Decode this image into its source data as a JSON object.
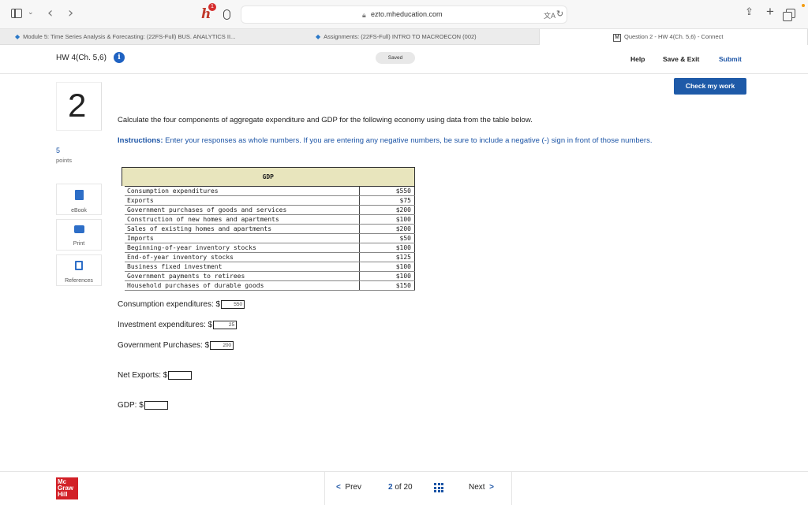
{
  "browser": {
    "url": "ezto.mheducation.com",
    "extension_badge": "1"
  },
  "tabs": [
    {
      "label": "Module 5: Time Series Analysis & Forecasting: (22FS-Full) BUS. ANALYTICS II..."
    },
    {
      "label": "Assignments: (22FS-Full) INTRO TO MACROECON (002)"
    },
    {
      "label": "Question 2 - HW 4(Ch. 5,6) - Connect"
    }
  ],
  "header": {
    "title": "HW 4(Ch. 5,6)",
    "saved": "Saved",
    "help": "Help",
    "save_exit": "Save & Exit",
    "submit": "Submit"
  },
  "check_my_work": "Check my work",
  "question": {
    "number": "2",
    "points_value": "5",
    "points_label": "points",
    "text": "Calculate the four components of aggregate expenditure and GDP for the following economy using data from the table below.",
    "instructions_label": "Instructions:",
    "instructions_text": " Enter your responses as whole numbers. If you are entering any negative numbers, be sure to include a negative (-) sign in front of those numbers."
  },
  "tools": {
    "ebook": "eBook",
    "print": "Print",
    "references": "References"
  },
  "table": {
    "header": "GDP",
    "rows": [
      {
        "label": "Consumption expenditures",
        "value": "$550"
      },
      {
        "label": "Exports",
        "value": "$75"
      },
      {
        "label": "Government purchases of goods and services",
        "value": "$200"
      },
      {
        "label": "Construction of new homes and apartments",
        "value": "$100"
      },
      {
        "label": "Sales of existing homes and apartments",
        "value": "$200"
      },
      {
        "label": "Imports",
        "value": "$50"
      },
      {
        "label": "Beginning-of-year inventory stocks",
        "value": "$100"
      },
      {
        "label": "End-of-year inventory stocks",
        "value": "$125"
      },
      {
        "label": "Business fixed investment",
        "value": "$100"
      },
      {
        "label": "Government payments to retirees",
        "value": "$100"
      },
      {
        "label": "Household purchases of durable goods",
        "value": "$150"
      }
    ]
  },
  "answers": {
    "consumption_label": "Consumption expenditures: $",
    "consumption_value": "550",
    "investment_label": "Investment expenditures: $",
    "investment_value": "25",
    "government_label": "Government Purchases: $",
    "government_value": "200",
    "net_exports_label": "Net Exports: $",
    "net_exports_value": "",
    "gdp_label": "GDP: $",
    "gdp_value": ""
  },
  "footer": {
    "logo_line1": "Mc",
    "logo_line2": "Graw",
    "logo_line3": "Hill",
    "prev": "Prev",
    "current": "2",
    "of_total": "of 20",
    "next": "Next"
  },
  "colors": {
    "accent_blue": "#1e5aa8",
    "table_header_bg": "#e8e5bd",
    "logo_red": "#d22027"
  }
}
